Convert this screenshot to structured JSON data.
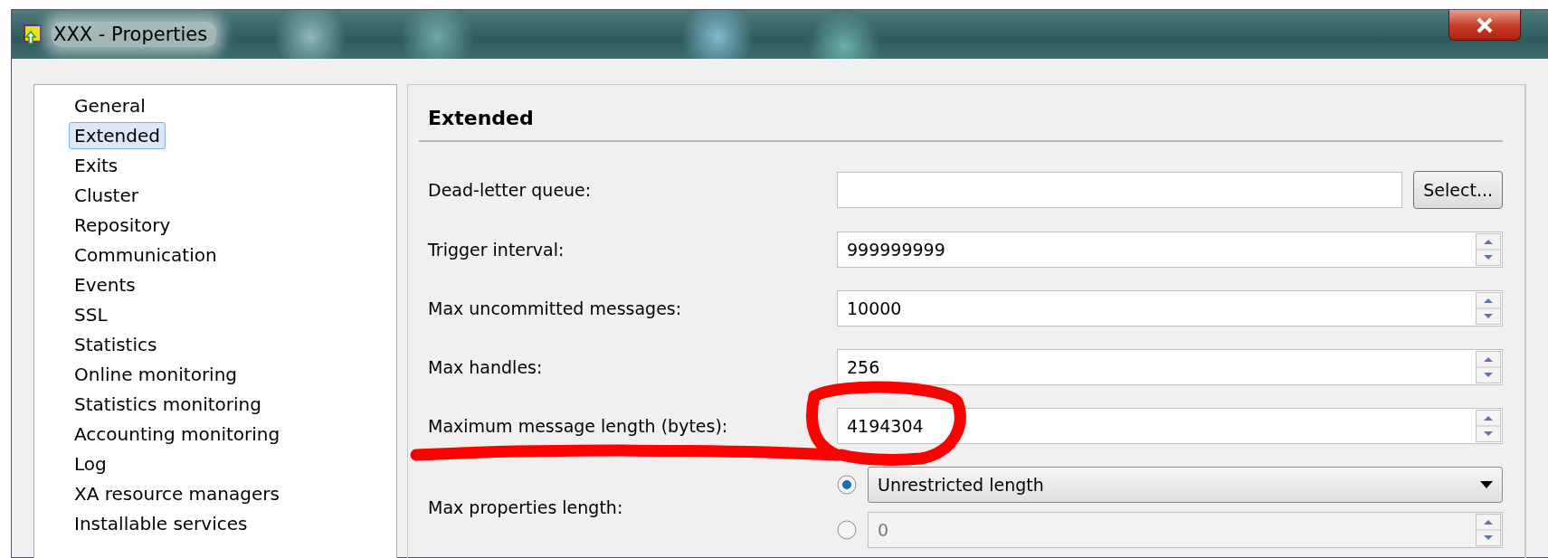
{
  "window": {
    "title": "XXX - Properties"
  },
  "sidebar": {
    "items": [
      {
        "label": "General",
        "selected": false
      },
      {
        "label": "Extended",
        "selected": true
      },
      {
        "label": "Exits",
        "selected": false
      },
      {
        "label": "Cluster",
        "selected": false
      },
      {
        "label": "Repository",
        "selected": false
      },
      {
        "label": "Communication",
        "selected": false
      },
      {
        "label": "Events",
        "selected": false
      },
      {
        "label": "SSL",
        "selected": false
      },
      {
        "label": "Statistics",
        "selected": false
      },
      {
        "label": "Online monitoring",
        "selected": false
      },
      {
        "label": "Statistics monitoring",
        "selected": false
      },
      {
        "label": "Accounting monitoring",
        "selected": false
      },
      {
        "label": "Log",
        "selected": false
      },
      {
        "label": "XA resource managers",
        "selected": false
      },
      {
        "label": "Installable services",
        "selected": false
      }
    ]
  },
  "panel": {
    "heading": "Extended",
    "fields": [
      {
        "kind": "text",
        "label": "Dead-letter queue:",
        "button": "Select..."
      },
      {
        "kind": "spin",
        "label": "Trigger interval:",
        "value": "999999999"
      },
      {
        "kind": "spin",
        "label": "Max uncommitted messages:",
        "value": "10000"
      },
      {
        "kind": "spin",
        "label": "Max handles:",
        "value": "256"
      },
      {
        "kind": "spin",
        "label": "Maximum message length (bytes):",
        "value": "4194304"
      },
      {
        "kind": "choice",
        "label": "Max properties length:",
        "options": [
          {
            "kind": "dropdown",
            "selected": true,
            "disabled": false,
            "value": "Unrestricted length"
          },
          {
            "kind": "spin",
            "selected": false,
            "disabled": true,
            "value": "0"
          }
        ]
      }
    ]
  }
}
